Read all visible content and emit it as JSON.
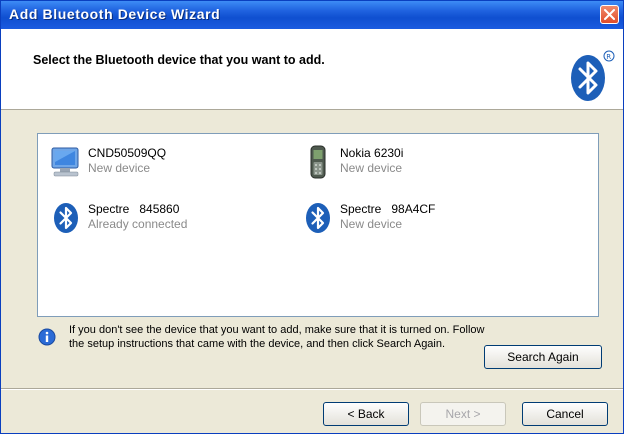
{
  "window": {
    "title": "Add Bluetooth Device Wizard"
  },
  "header": {
    "heading": "Select the Bluetooth device that you want to add."
  },
  "devices": [
    {
      "name": "CND50509QQ",
      "status": "New device",
      "icon": "computer-icon"
    },
    {
      "name": "Nokia 6230i",
      "status": "New device",
      "icon": "mobile-phone-icon"
    },
    {
      "name": "Spectre   845860",
      "status": "Already connected",
      "icon": "bluetooth-device-icon"
    },
    {
      "name": "Spectre   98A4CF",
      "status": "New device",
      "icon": "bluetooth-device-icon"
    }
  ],
  "info": {
    "text": "If you don't see the device that you want to add, make sure that it is turned on. Follow the setup instructions that came with the device, and then click Search Again."
  },
  "buttons": {
    "search_again": "Search Again",
    "back": "< Back",
    "next": "Next >",
    "cancel": "Cancel"
  },
  "colors": {
    "titlebar": "#0f4fd0",
    "window_bg": "#ece9d8",
    "bluetooth_blue": "#1d5fb8"
  }
}
